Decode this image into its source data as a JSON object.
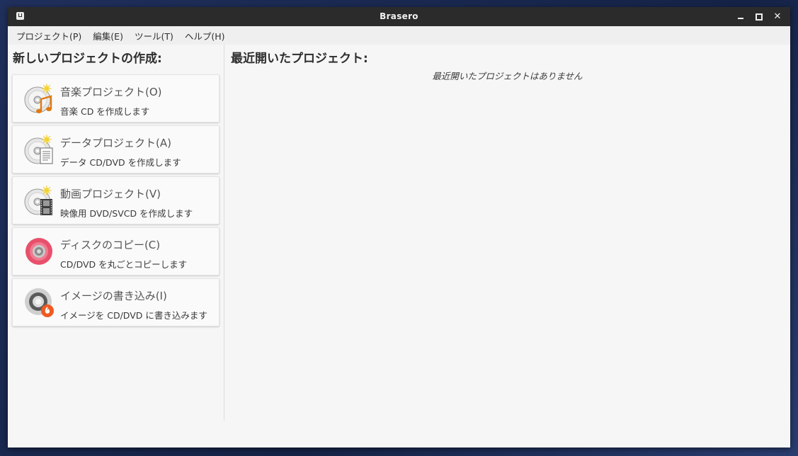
{
  "window": {
    "title": "Brasero"
  },
  "menubar": {
    "items": [
      "プロジェクト(P)",
      "編集(E)",
      "ツール(T)",
      "ヘルプ(H)"
    ]
  },
  "new_project": {
    "heading": "新しいプロジェクトの作成:",
    "buttons": [
      {
        "label": "音楽プロジェクト(O)",
        "desc": "音楽 CD を作成します",
        "icon": "audio-cd-icon"
      },
      {
        "label": "データプロジェクト(A)",
        "desc": "データ CD/DVD を作成します",
        "icon": "data-cd-icon"
      },
      {
        "label": "動画プロジェクト(V)",
        "desc": "映像用 DVD/SVCD を作成します",
        "icon": "video-dvd-icon"
      },
      {
        "label": "ディスクのコピー(C)",
        "desc": "CD/DVD を丸ごとコピーします",
        "icon": "disc-copy-icon"
      },
      {
        "label": "イメージの書き込み(I)",
        "desc": "イメージを CD/DVD に書き込みます",
        "icon": "image-burn-icon"
      }
    ]
  },
  "recent": {
    "heading": "最近開いたプロジェクト:",
    "empty_message": "最近開いたプロジェクトはありません"
  },
  "colors": {
    "titlebar": "#2b2b2b",
    "window_bg": "#f6f6f6",
    "copy_accent": "#e8506c",
    "burn_accent": "#f05a22",
    "music_note": "#e07a10"
  }
}
